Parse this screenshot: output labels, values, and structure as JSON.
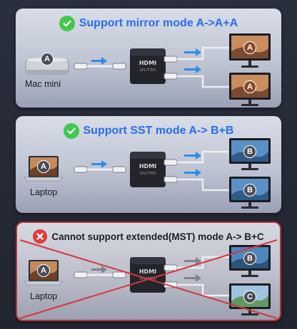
{
  "panel1": {
    "title": "Support mirror mode A->A+A",
    "source_label": "Mac mini",
    "source_badge": "A",
    "output_badges": [
      "A",
      "A"
    ],
    "status": "supported"
  },
  "panel2": {
    "title": "Support SST mode A-> B+B",
    "source_label": "Laptop",
    "source_badge": "A",
    "output_badges": [
      "B",
      "B"
    ],
    "status": "supported"
  },
  "panel3": {
    "title": "Cannot support extended(MST) mode A-> B+C",
    "source_label": "Laptop",
    "source_badge": "A",
    "output_badges": [
      "B",
      "C"
    ],
    "status": "unsupported"
  },
  "splitter": {
    "brand_text": "HDMI",
    "sub_text": "SPLITTER"
  },
  "colors": {
    "title_blue": "#2a6cf0",
    "check_green": "#3fc94d",
    "error_red": "#e23b3b",
    "arrow_blue": "#2f8de8",
    "arrow_gray": "#7f838c"
  },
  "icons": {
    "supported": "check-circle-icon",
    "unsupported": "x-circle-icon"
  }
}
